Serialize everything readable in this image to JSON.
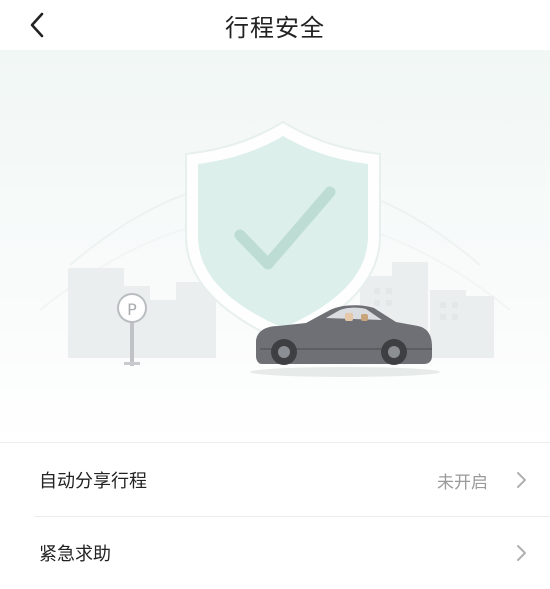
{
  "header": {
    "title": "行程安全"
  },
  "rows": [
    {
      "label": "自动分享行程",
      "status": "未开启"
    },
    {
      "label": "紧急求助",
      "status": ""
    }
  ],
  "icons": {
    "back": "chevron-left-icon",
    "chevron": "chevron-right-icon",
    "shield": "shield-check-icon",
    "parking": "parking-sign-icon",
    "car": "car-icon"
  },
  "colors": {
    "shield_fill": "#dcefea",
    "check": "#bcdcd4",
    "car": "#6e7075",
    "hint_text": "#9a9a9a"
  }
}
